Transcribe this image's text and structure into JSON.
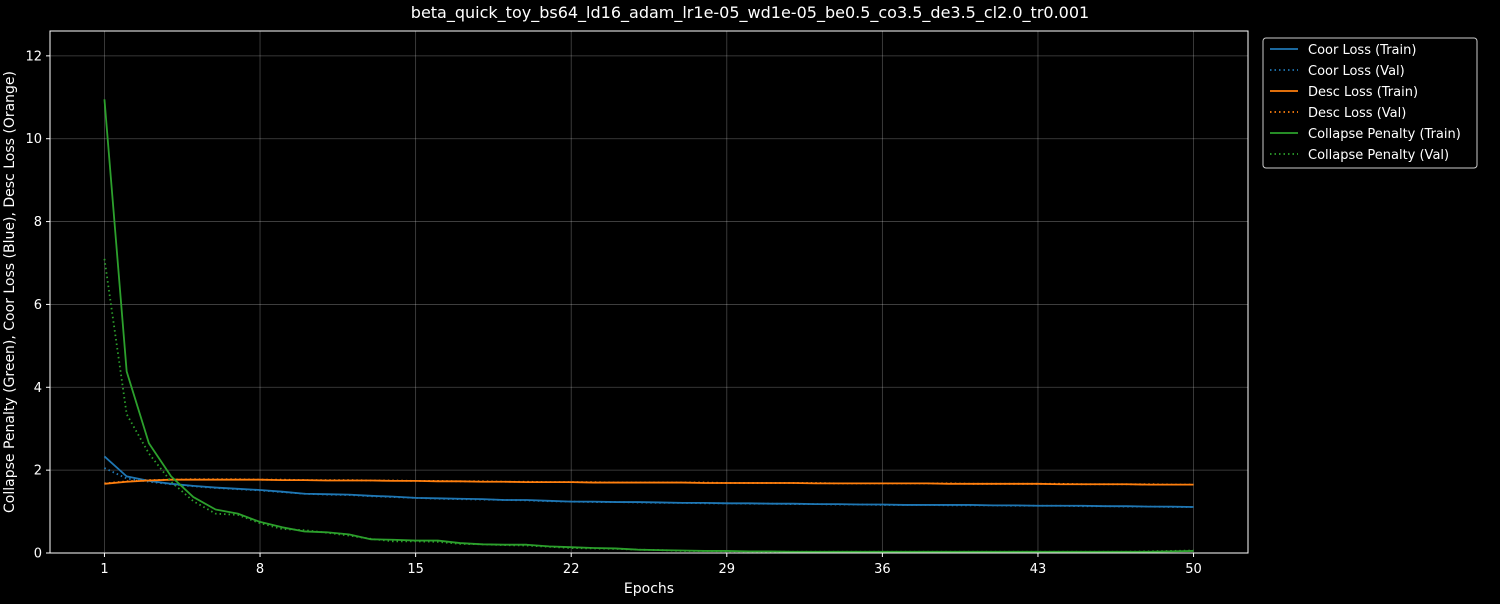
{
  "chart_data": {
    "type": "line",
    "title": "beta_quick_toy_bs64_ld16_adam_lr1e-05_wd1e-05_be0.5_co3.5_de3.5_cl2.0_tr0.001",
    "xlabel": "Epochs",
    "ylabel": "Collapse Penalty (Green), Coor Loss (Blue), Desc Loss (Orange)",
    "xlim": [
      -1.45,
      52.45
    ],
    "ylim": [
      0,
      12.6
    ],
    "xticks": [
      1,
      8,
      15,
      22,
      29,
      36,
      43,
      50
    ],
    "yticks": [
      0,
      2,
      4,
      6,
      8,
      10,
      12
    ],
    "grid": true,
    "legend_position": "outside-top-right",
    "background": "#000000",
    "foreground": "#ffffff",
    "x": [
      1,
      2,
      3,
      4,
      5,
      6,
      7,
      8,
      9,
      10,
      11,
      12,
      13,
      14,
      15,
      16,
      17,
      18,
      19,
      20,
      21,
      22,
      23,
      24,
      25,
      26,
      27,
      28,
      29,
      30,
      31,
      32,
      33,
      34,
      35,
      36,
      37,
      38,
      39,
      40,
      41,
      42,
      43,
      44,
      45,
      46,
      47,
      48,
      49,
      50
    ],
    "series": [
      {
        "name": "Coor Loss (Train)",
        "color": "#1f77b4",
        "style": "solid",
        "values": [
          2.33,
          1.85,
          1.74,
          1.67,
          1.62,
          1.58,
          1.55,
          1.52,
          1.48,
          1.43,
          1.42,
          1.41,
          1.38,
          1.36,
          1.33,
          1.32,
          1.31,
          1.3,
          1.28,
          1.28,
          1.26,
          1.24,
          1.24,
          1.23,
          1.23,
          1.22,
          1.21,
          1.21,
          1.2,
          1.2,
          1.19,
          1.19,
          1.18,
          1.18,
          1.17,
          1.17,
          1.16,
          1.16,
          1.16,
          1.16,
          1.15,
          1.15,
          1.14,
          1.14,
          1.14,
          1.13,
          1.13,
          1.12,
          1.12,
          1.11
        ]
      },
      {
        "name": "Coor Loss (Val)",
        "color": "#1f77b4",
        "style": "dotted",
        "values": [
          2.05,
          1.8,
          1.72,
          1.66,
          1.61,
          1.57,
          1.54,
          1.51,
          1.47,
          1.43,
          1.41,
          1.4,
          1.37,
          1.35,
          1.33,
          1.31,
          1.3,
          1.29,
          1.28,
          1.27,
          1.25,
          1.24,
          1.23,
          1.23,
          1.22,
          1.21,
          1.21,
          1.2,
          1.2,
          1.19,
          1.19,
          1.18,
          1.18,
          1.17,
          1.17,
          1.16,
          1.16,
          1.16,
          1.15,
          1.15,
          1.15,
          1.14,
          1.14,
          1.14,
          1.13,
          1.13,
          1.12,
          1.12,
          1.11,
          1.11
        ]
      },
      {
        "name": "Desc Loss (Train)",
        "color": "#ff7f0e",
        "style": "solid",
        "values": [
          1.67,
          1.72,
          1.75,
          1.77,
          1.77,
          1.77,
          1.77,
          1.77,
          1.76,
          1.76,
          1.75,
          1.75,
          1.75,
          1.74,
          1.74,
          1.73,
          1.73,
          1.72,
          1.72,
          1.71,
          1.71,
          1.71,
          1.7,
          1.7,
          1.7,
          1.7,
          1.7,
          1.69,
          1.69,
          1.69,
          1.69,
          1.69,
          1.68,
          1.68,
          1.68,
          1.68,
          1.68,
          1.68,
          1.67,
          1.67,
          1.67,
          1.67,
          1.67,
          1.66,
          1.66,
          1.66,
          1.66,
          1.65,
          1.65,
          1.65
        ]
      },
      {
        "name": "Desc Loss (Val)",
        "color": "#ff7f0e",
        "style": "dotted",
        "values": [
          1.68,
          1.73,
          1.76,
          1.77,
          1.78,
          1.78,
          1.78,
          1.77,
          1.77,
          1.76,
          1.76,
          1.76,
          1.75,
          1.75,
          1.74,
          1.74,
          1.73,
          1.73,
          1.72,
          1.72,
          1.71,
          1.71,
          1.71,
          1.7,
          1.7,
          1.7,
          1.7,
          1.7,
          1.69,
          1.69,
          1.69,
          1.69,
          1.69,
          1.68,
          1.68,
          1.68,
          1.68,
          1.68,
          1.68,
          1.67,
          1.67,
          1.67,
          1.67,
          1.67,
          1.66,
          1.66,
          1.66,
          1.66,
          1.65,
          1.65
        ]
      },
      {
        "name": "Collapse Penalty (Train)",
        "color": "#2ca02c",
        "style": "solid",
        "values": [
          10.95,
          4.38,
          2.65,
          1.85,
          1.35,
          1.05,
          0.95,
          0.75,
          0.62,
          0.52,
          0.5,
          0.45,
          0.33,
          0.32,
          0.3,
          0.3,
          0.24,
          0.21,
          0.2,
          0.2,
          0.16,
          0.14,
          0.12,
          0.11,
          0.08,
          0.07,
          0.06,
          0.05,
          0.05,
          0.04,
          0.04,
          0.03,
          0.03,
          0.03,
          0.03,
          0.03,
          0.03,
          0.03,
          0.03,
          0.03,
          0.03,
          0.03,
          0.03,
          0.03,
          0.03,
          0.03,
          0.03,
          0.03,
          0.04,
          0.05
        ]
      },
      {
        "name": "Collapse Penalty (Val)",
        "color": "#2ca02c",
        "style": "dotted",
        "values": [
          7.1,
          3.35,
          2.4,
          1.72,
          1.25,
          0.95,
          0.92,
          0.72,
          0.58,
          0.55,
          0.49,
          0.42,
          0.34,
          0.28,
          0.28,
          0.27,
          0.22,
          0.21,
          0.19,
          0.18,
          0.15,
          0.12,
          0.11,
          0.1,
          0.08,
          0.07,
          0.05,
          0.05,
          0.04,
          0.04,
          0.03,
          0.03,
          0.03,
          0.03,
          0.03,
          0.03,
          0.03,
          0.03,
          0.03,
          0.03,
          0.03,
          0.03,
          0.03,
          0.03,
          0.03,
          0.03,
          0.03,
          0.04,
          0.05,
          0.06
        ]
      }
    ]
  }
}
